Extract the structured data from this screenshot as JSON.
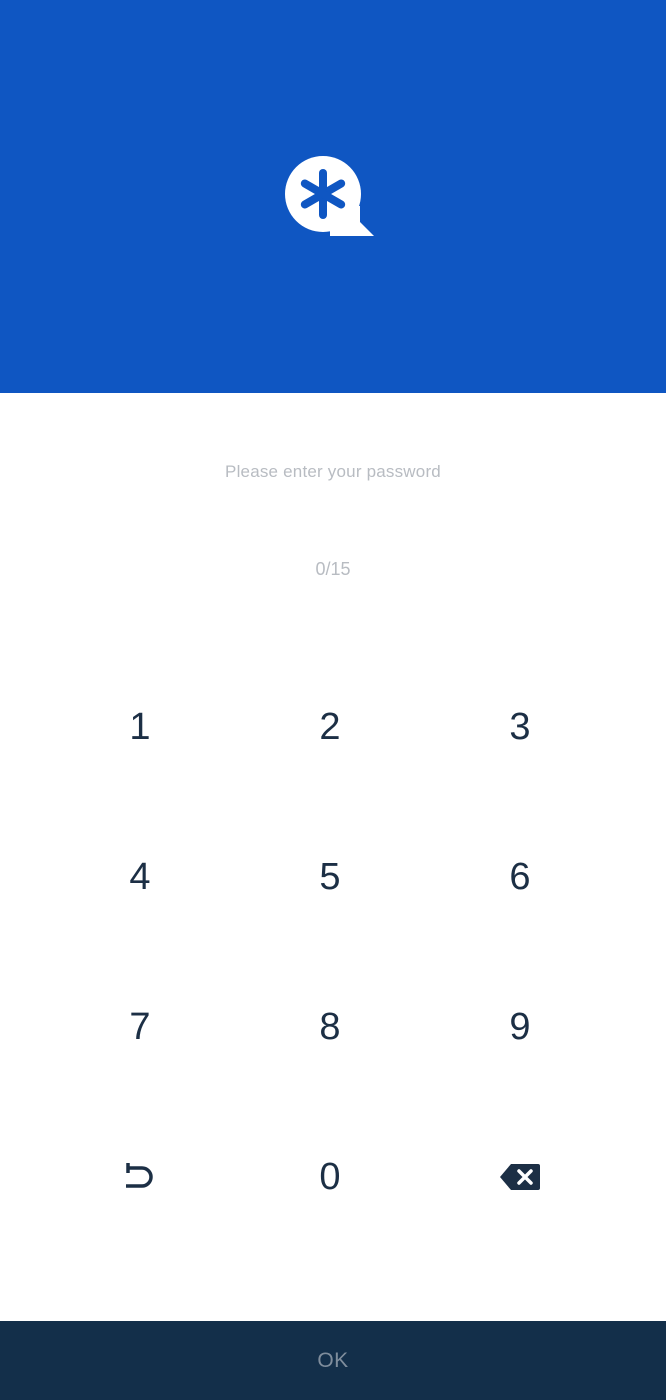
{
  "colors": {
    "header_bg": "#0f56c2",
    "key_text": "#1c2f45",
    "hint_text": "#b8bcc2",
    "ok_bar_bg": "#132f4a",
    "ok_text": "#7f8d9c"
  },
  "header": {
    "logo_icon": "asterisk-speech-bubble-icon"
  },
  "prompt": {
    "text": "Please enter your password"
  },
  "counter": {
    "text": "0/15"
  },
  "keypad": {
    "keys": [
      "1",
      "2",
      "3",
      "4",
      "5",
      "6",
      "7",
      "8",
      "9"
    ],
    "zero": "0",
    "left_icon": "undo-return-icon",
    "right_icon": "backspace-icon"
  },
  "ok_bar": {
    "label": "OK"
  }
}
